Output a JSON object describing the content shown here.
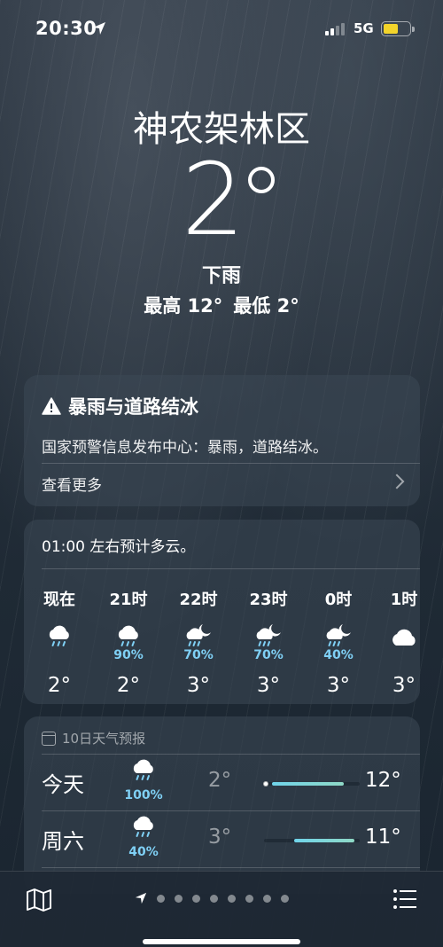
{
  "status": {
    "time": "20:30",
    "network": "5G",
    "battery_color": "#f2d42b"
  },
  "header": {
    "city": "神农架林区",
    "temperature": "2",
    "condition": "下雨",
    "high": "最高 12°",
    "low": "最低 2°"
  },
  "alert": {
    "icon": "warning-triangle-icon",
    "title": "暴雨与道路结冰",
    "body": "国家预警信息发布中心：暴雨，道路结冰。",
    "more": "查看更多"
  },
  "hourly": {
    "summary": "01:00 左右预计多云。",
    "hours": [
      {
        "label": "现在",
        "icon": "rain-cloud-icon",
        "pct": "",
        "temp": "2°"
      },
      {
        "label": "21时",
        "icon": "rain-cloud-icon",
        "pct": "90%",
        "temp": "2°"
      },
      {
        "label": "22时",
        "icon": "rain-moon-cloud-icon",
        "pct": "70%",
        "temp": "3°"
      },
      {
        "label": "23时",
        "icon": "rain-moon-cloud-icon",
        "pct": "70%",
        "temp": "3°"
      },
      {
        "label": "0时",
        "icon": "rain-moon-cloud-icon",
        "pct": "40%",
        "temp": "3°"
      },
      {
        "label": "1时",
        "icon": "cloud-icon",
        "pct": "",
        "temp": "3°"
      }
    ]
  },
  "daily": {
    "header": "10日天气预报",
    "days": [
      {
        "name": "今天",
        "icon": "rain-cloud-icon",
        "pct": "100%",
        "low": "2°",
        "high": "12°",
        "current_marker": true
      },
      {
        "name": "周六",
        "icon": "rain-cloud-icon",
        "pct": "40%",
        "low": "3°",
        "high": "11°",
        "current_marker": false
      }
    ]
  },
  "bottom": {
    "map_icon": "map-icon",
    "location_icon": "location-arrow-icon",
    "page_dots": 8,
    "list_icon": "list-icon"
  },
  "colors": {
    "accent_precip": "#7fd0f5",
    "temp_bar": "#70d4ea"
  }
}
